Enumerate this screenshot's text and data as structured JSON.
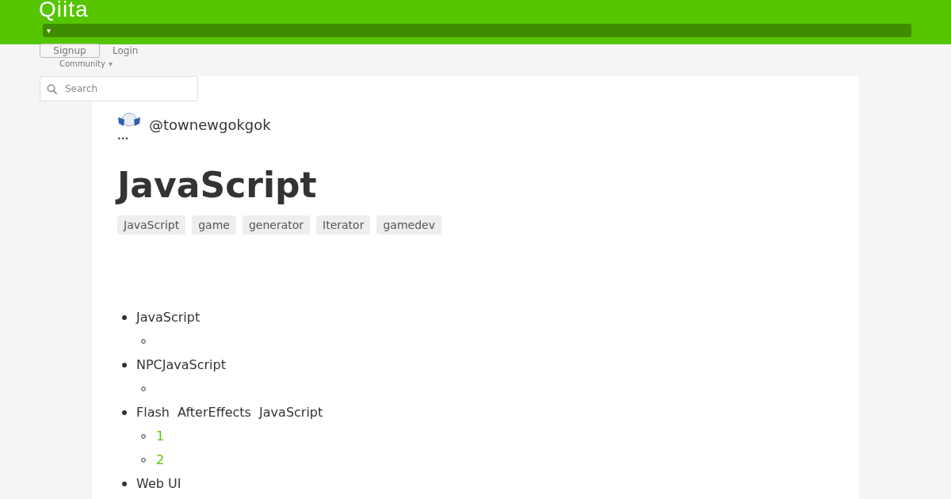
{
  "header": {
    "logo": "Qiita",
    "menu_caret": "▾",
    "signup": "Signup",
    "login": "Login",
    "community": "Community",
    "community_caret": "▾"
  },
  "search": {
    "placeholder": "Search"
  },
  "article": {
    "author": "@townewgokgok",
    "more": "•••",
    "title": "JavaScript",
    "tags": [
      "JavaScript",
      "game",
      "generator",
      "Iterator",
      "gamedev"
    ],
    "outline": [
      {
        "text": "JavaScript",
        "children": [
          {
            "kind": "blank"
          }
        ]
      },
      {
        "text": "NPCJavaScript",
        "children": [
          {
            "kind": "blank"
          }
        ]
      },
      {
        "text": "Flash  AfterEffects  JavaScript",
        "children": [
          {
            "kind": "link",
            "text": "1"
          },
          {
            "kind": "link",
            "text": "2"
          }
        ]
      },
      {
        "text": "Web UI"
      }
    ]
  }
}
